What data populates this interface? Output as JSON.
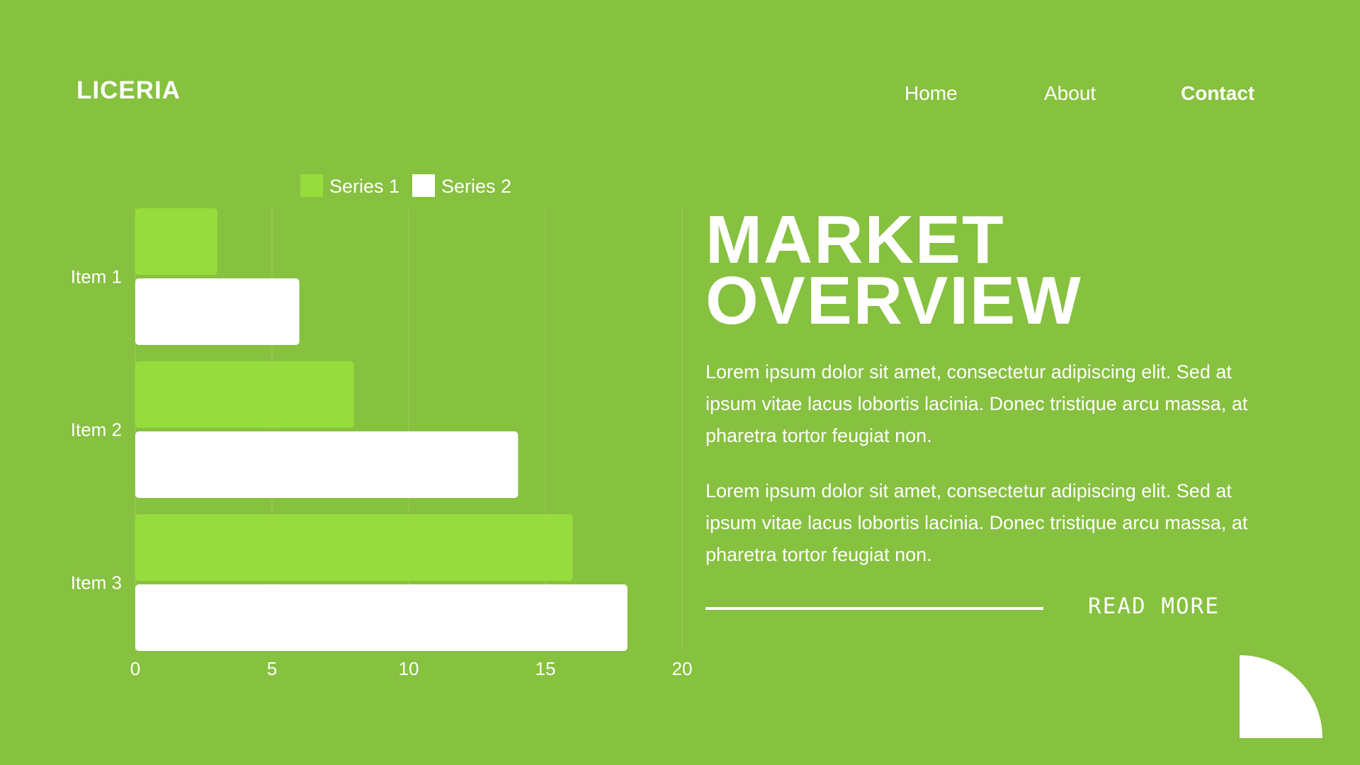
{
  "brand": {
    "logo": "LICERIA"
  },
  "nav": {
    "home": "Home",
    "about": "About",
    "contact": "Contact"
  },
  "hero": {
    "title_line1": "MARKET",
    "title_line2": "OVERVIEW",
    "paragraph1": "Lorem ipsum dolor sit amet, consectetur adipiscing elit. Sed at ipsum vitae lacus lobortis lacinia. Donec tristique arcu massa, at pharetra tortor feugiat non.",
    "paragraph2": "Lorem ipsum dolor sit amet, consectetur adipiscing elit. Sed at ipsum vitae lacus lobortis lacinia. Donec tristique arcu massa, at pharetra tortor feugiat non.",
    "read_more": "READ MORE"
  },
  "colors": {
    "background": "#86c13f",
    "series1": "#97dc3d",
    "series2": "#ffffff",
    "grid": "#9dcd5f"
  },
  "chart_data": {
    "type": "bar",
    "orientation": "horizontal",
    "categories": [
      "Item 1",
      "Item 2",
      "Item 3"
    ],
    "series": [
      {
        "name": "Series 1",
        "values": [
          3,
          8,
          16
        ]
      },
      {
        "name": "Series 2",
        "values": [
          6,
          14,
          18
        ]
      }
    ],
    "xlim": [
      0,
      20
    ],
    "xticks": [
      0,
      5,
      10,
      15,
      20
    ],
    "grid": true,
    "legend": "top"
  }
}
